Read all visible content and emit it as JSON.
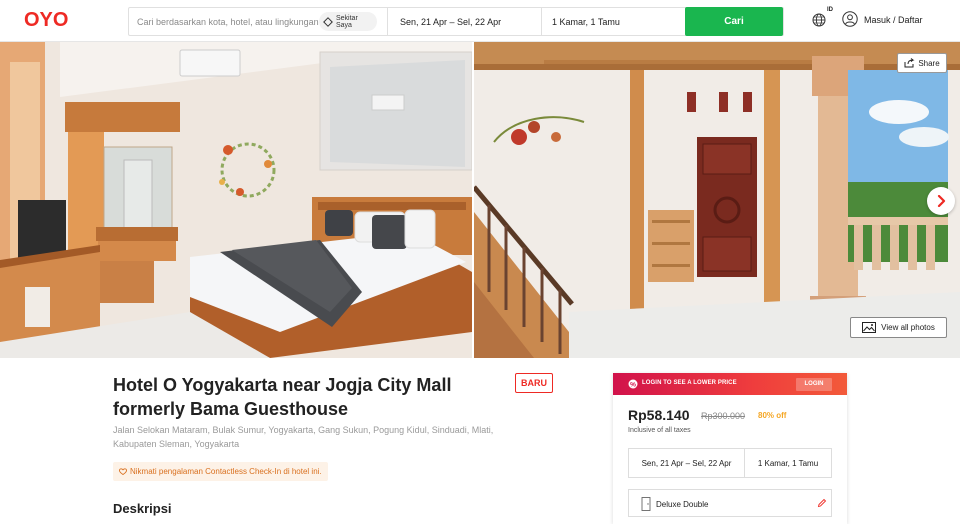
{
  "header": {
    "logo": "OYO",
    "search_placeholder": "Cari berdasarkan kota, hotel, atau lingkungan",
    "near_me_label_1": "Sekitar",
    "near_me_label_2": "Saya",
    "dates": "Sen, 21 Apr – Sel, 22 Apr",
    "rooms_guests": "1 Kamar, 1 Tamu",
    "search_button": "Cari",
    "language_code": "ID",
    "login_label": "Masuk / Daftar"
  },
  "gallery": {
    "share_label": "Share",
    "view_all_label": "View all photos"
  },
  "hotel": {
    "title": "Hotel O Yogyakarta near Jogja City Mall formerly Bama Guesthouse",
    "badge": "BARU",
    "address": "Jalan Selokan Mataram, Bulak Sumur, Yogyakarta, Gang Sukun, Pogung Kidul, Sinduadi, Mlati, Kabupaten Sleman, Yogyakarta",
    "promo": "Nikmati pengalaman Contactless Check-In di hotel ini.",
    "description_heading": "Deskripsi"
  },
  "booking": {
    "banner_text": "LOGIN TO SEE A LOWER PRICE",
    "login_button": "LOGIN",
    "price": "Rp58.140",
    "original_price": "Rp300.000",
    "discount": "80% off",
    "tax_note": "Inclusive of all taxes",
    "dates": "Sen, 21 Apr – Sel, 22 Apr",
    "rooms_guests": "1 Kamar, 1 Tamu",
    "room_type": "Deluxe Double"
  },
  "colors": {
    "brand_red": "#ee2a24",
    "search_green": "#1ab64f",
    "discount_orange": "#f5a623",
    "banner_red": "#d1124b"
  }
}
